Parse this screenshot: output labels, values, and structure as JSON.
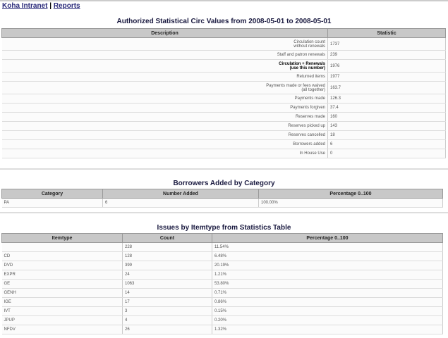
{
  "nav": {
    "home": "Koha Intranet",
    "sep": " | ",
    "reports": "Reports"
  },
  "circ": {
    "title": "Authorized Statistical Circ Values from 2008-05-01 to 2008-05-01",
    "headers": [
      "Description",
      "Statistic"
    ],
    "rows": [
      {
        "desc": "Circulation count",
        "desc2": "without renewals",
        "value": "1737"
      },
      {
        "desc": "Staff and patron renewals",
        "desc2": "",
        "value": "239"
      },
      {
        "desc": "Circulation + Renewals",
        "desc2": "(use this number)",
        "value": "1976"
      },
      {
        "desc": "Returned items",
        "desc2": "",
        "value": "1977"
      },
      {
        "desc": "Payments made or fees waived",
        "desc2": "(all together)",
        "value": "163.7"
      },
      {
        "desc": "Payments made",
        "desc2": "",
        "value": "126.3"
      },
      {
        "desc": "Payments forgiven",
        "desc2": "",
        "value": "37.4"
      },
      {
        "desc": "Reserves made",
        "desc2": "",
        "value": "160"
      },
      {
        "desc": "Reserves picked up",
        "desc2": "",
        "value": "143"
      },
      {
        "desc": "Reserves cancelled",
        "desc2": "",
        "value": "18"
      },
      {
        "desc": "Borrowers added",
        "desc2": "",
        "value": "6"
      },
      {
        "desc": "In House Use",
        "desc2": "",
        "value": "0"
      }
    ]
  },
  "borrowers": {
    "title": "Borrowers Added by Category",
    "headers": [
      "Category",
      "Number Added",
      "Percentage 0..100"
    ],
    "rows": [
      [
        "PA",
        "6",
        "100.00%"
      ]
    ]
  },
  "issues": {
    "title": "Issues by Itemtype from Statistics Table",
    "headers": [
      "Itemtype",
      "Count",
      "Percentage 0..100"
    ],
    "rows": [
      [
        "",
        "228",
        "11.54%"
      ],
      [
        "CD",
        "128",
        "6.48%"
      ],
      [
        "DVD",
        "399",
        "20.19%"
      ],
      [
        "EXPR",
        "24",
        "1.21%"
      ],
      [
        "GE",
        "1063",
        "53.80%"
      ],
      [
        "GENH",
        "14",
        "0.71%"
      ],
      [
        "IGE",
        "17",
        "0.86%"
      ],
      [
        "IVT",
        "3",
        "0.15%"
      ],
      [
        "JPUP",
        "4",
        "0.20%"
      ],
      [
        "NFDV",
        "26",
        "1.32%"
      ]
    ]
  }
}
